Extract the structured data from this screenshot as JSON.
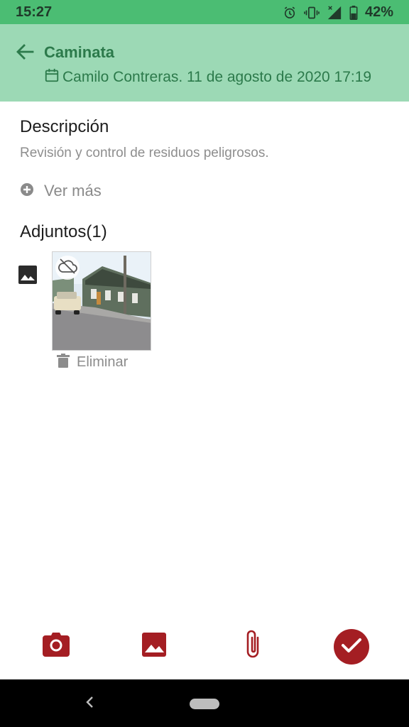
{
  "status_bar": {
    "time": "15:27",
    "battery": "42%",
    "icons": [
      "alarm-icon",
      "vibrate-icon",
      "signal-icon",
      "battery-icon"
    ]
  },
  "app_bar": {
    "back_icon": "arrow-back-icon",
    "title": "Caminata",
    "subtitle": "Camilo Contreras. 11 de agosto de 2020 17:19",
    "subtitle_icon": "calendar-icon"
  },
  "description": {
    "heading": "Descripción",
    "text": "Revisión y control de residuos peligrosos.",
    "more_label": "Ver más"
  },
  "attachments": {
    "heading": "Adjuntos(1)",
    "items": [
      {
        "type_icon": "image-icon",
        "badge_icon": "cloud-off-icon",
        "delete_label": "Eliminar"
      }
    ]
  },
  "bottom_actions": [
    "camera-icon",
    "image-icon",
    "attach-icon",
    "check-icon"
  ],
  "colors": {
    "status_bar": "#4bbd73",
    "app_bar": "#9cd9b5",
    "title_green": "#2c7a4b",
    "action_red": "#a41e23"
  }
}
